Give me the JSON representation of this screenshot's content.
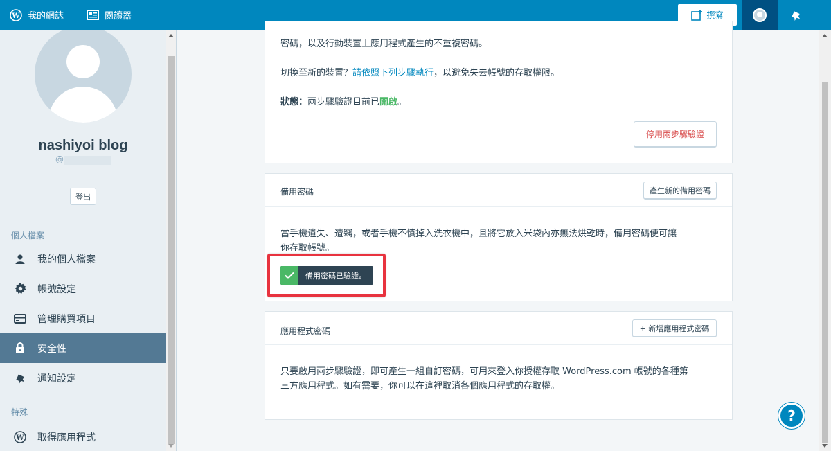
{
  "masterbar": {
    "my_sites": "我的網誌",
    "reader": "閱讀器",
    "write": "撰寫"
  },
  "sidebar": {
    "blog_name": "nashiyoi blog",
    "handle_prefix": "@",
    "logout": "登出",
    "section_profile": "個人檔案",
    "items": [
      {
        "label": "我的個人檔案",
        "icon": "person-icon"
      },
      {
        "label": "帳號設定",
        "icon": "gear-icon"
      },
      {
        "label": "管理購買項目",
        "icon": "credit-card-icon"
      },
      {
        "label": "安全性",
        "icon": "lock-icon"
      },
      {
        "label": "通知設定",
        "icon": "bell-icon"
      }
    ],
    "section_special": "特殊",
    "special_items": [
      {
        "label": "取得應用程式",
        "icon": "wordpress-icon"
      }
    ]
  },
  "two_step": {
    "line1": "密碼，以及行動裝置上應用程式產生的不重複密碼。",
    "switch_prefix": "切換至新的裝置？",
    "switch_link": "請依照下列步驟執行",
    "switch_suffix": "，以避免失去帳號的存取權限。",
    "status_label": "狀態：",
    "status_text": "兩步驟驗證目前已",
    "status_value": "開啟",
    "status_end": "。",
    "disable_button": "停用兩步驟驗證"
  },
  "backup_codes": {
    "title": "備用密碼",
    "generate_button": "產生新的備用密碼",
    "description_line1": "當手機遺失、遭竊，或者手機不慎掉入洗衣機中，且將它放入米袋內亦無法烘乾時，備用密碼便可讓",
    "description_line2": "你存取帳號。",
    "verified_notice": "備用密碼已驗證。"
  },
  "app_passwords": {
    "title": "應用程式密碼",
    "add_button": "+ 新增應用程式密碼",
    "description_line1": "只要啟用兩步驟驗證，即可產生一組自訂密碼，可用來登入你授權存取 WordPress.com 帳號的各種第",
    "description_line2": "三方應用程式。如有需要，你可以在這裡取消各個應用程式的存取權。"
  },
  "help": {
    "label": "?"
  },
  "colors": {
    "masterbar": "#0087be",
    "sidebar_active": "#537994",
    "success": "#4ab866",
    "danger": "#d94f4f",
    "highlight_frame": "#e8333f"
  }
}
